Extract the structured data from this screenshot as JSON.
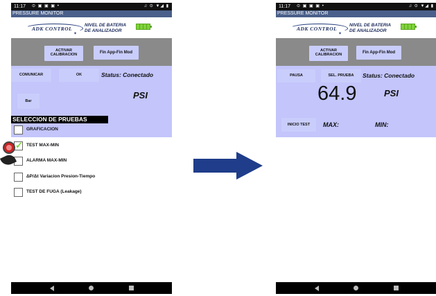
{
  "status_bar": {
    "time": "11:17",
    "left_icons": "⊙ ▣ ▣ ▣ •",
    "right_icons": "♫ ⊙ ▼◢ ▮"
  },
  "app_title": "PRESSURE MONITOR",
  "logo_text": "ADK CONTROL",
  "battery_label_line1": "NIVEL DE BATERIA",
  "battery_label_line2": "DE ANALIZADOR",
  "battery_color": "#7fd33a",
  "left_screen": {
    "activar_line1": "ACTIVAR",
    "activar_line2": "CALIBRACION",
    "fin_app": "Fin App-Fin Mod",
    "comunicar": "COMUNICAR",
    "ok": "OK",
    "status": "Status: Conectado",
    "bar": "Bar",
    "psi": "PSI",
    "section_title": "SELECCION DE PRUEBAS",
    "tests": [
      {
        "label": "GRAFICACION",
        "checked": false
      },
      {
        "label": "TEST MAX-MIN",
        "checked": true
      },
      {
        "label": "ALARMA MAX-MIN",
        "checked": false
      },
      {
        "label": "ΔP/Δt Variacion Presion-Tiempo",
        "checked": false
      },
      {
        "label": "TEST DE FUGA (Leakage)",
        "checked": false
      }
    ]
  },
  "right_screen": {
    "activar_line1": "ACTIVAR",
    "activar_line2": "CALIBRACION",
    "fin_app": "Fin App-Fin Mod",
    "pausa": "PAUSA",
    "sel_prueba": "SEL. PRUEBA",
    "status": "Status: Conectado",
    "value": "64.9",
    "psi": "PSI",
    "inicio_test": "INICIO TEST",
    "max": "MAX:",
    "min": "MIN:"
  },
  "colors": {
    "app_bar": "#4a5f8a",
    "gray_panel": "#8a8a8a",
    "blue_panel": "#c3c5fb",
    "button": "#c9cdfb",
    "arrow": "#1f3d8a"
  },
  "icons": [
    "back-icon",
    "home-icon",
    "recents-icon",
    "battery-icon",
    "right-arrow-icon",
    "touch-indicator-icon"
  ]
}
